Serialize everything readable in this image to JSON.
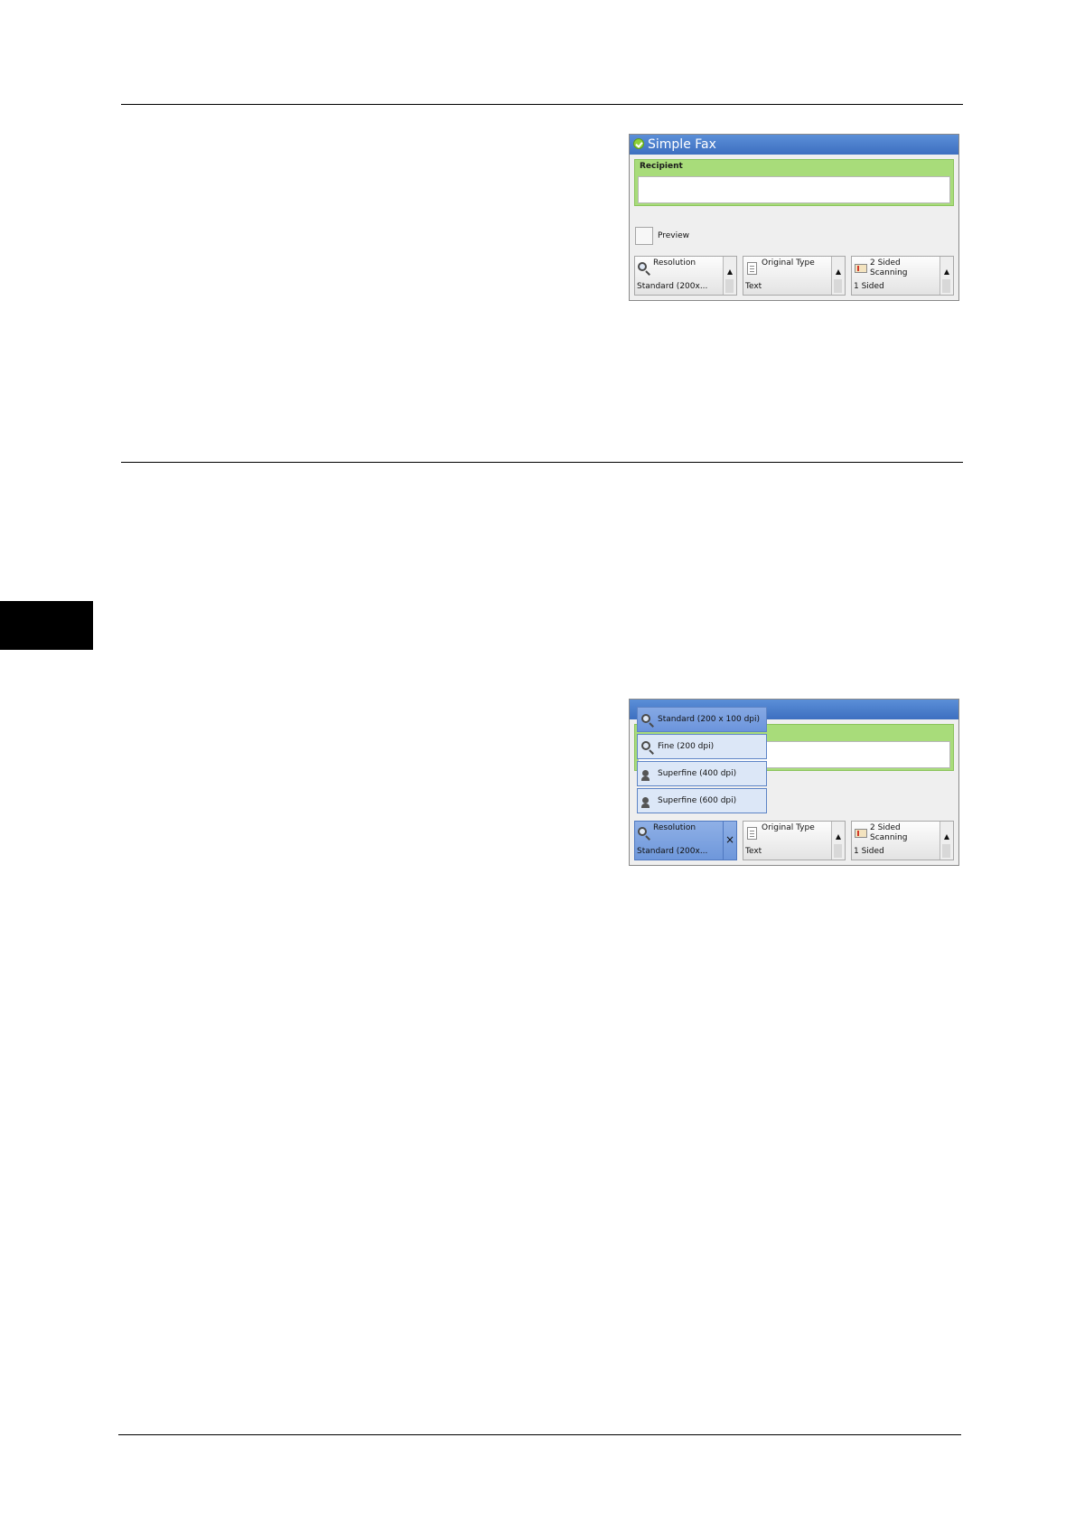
{
  "panel_top": {
    "title": "Simple Fax",
    "recipient_label": "Recipient",
    "recipient_value": "",
    "preview_label": "Preview",
    "features": [
      {
        "name": "Resolution",
        "value": "Standard (200x..."
      },
      {
        "name": "Original Type",
        "value": "Text"
      },
      {
        "name": "2 Sided Scanning",
        "value": "1 Sided"
      }
    ]
  },
  "panel_bottom": {
    "resolution_options": [
      {
        "label": "Standard (200 x 100 dpi)",
        "selected": true
      },
      {
        "label": "Fine (200 dpi)",
        "selected": false
      },
      {
        "label": "Superfine (400 dpi)",
        "selected": false
      },
      {
        "label": "Superfine (600 dpi)",
        "selected": false
      }
    ],
    "features": [
      {
        "name": "Resolution",
        "value": "Standard (200x..."
      },
      {
        "name": "Original Type",
        "value": "Text"
      },
      {
        "name": "2 Sided Scanning",
        "value": "1 Sided"
      }
    ]
  },
  "colors": {
    "titlebar": "#4a7fcc",
    "recipient_bg": "#a8dc7a",
    "active_button": "#7ba0e0",
    "side_tab": "#000000"
  }
}
